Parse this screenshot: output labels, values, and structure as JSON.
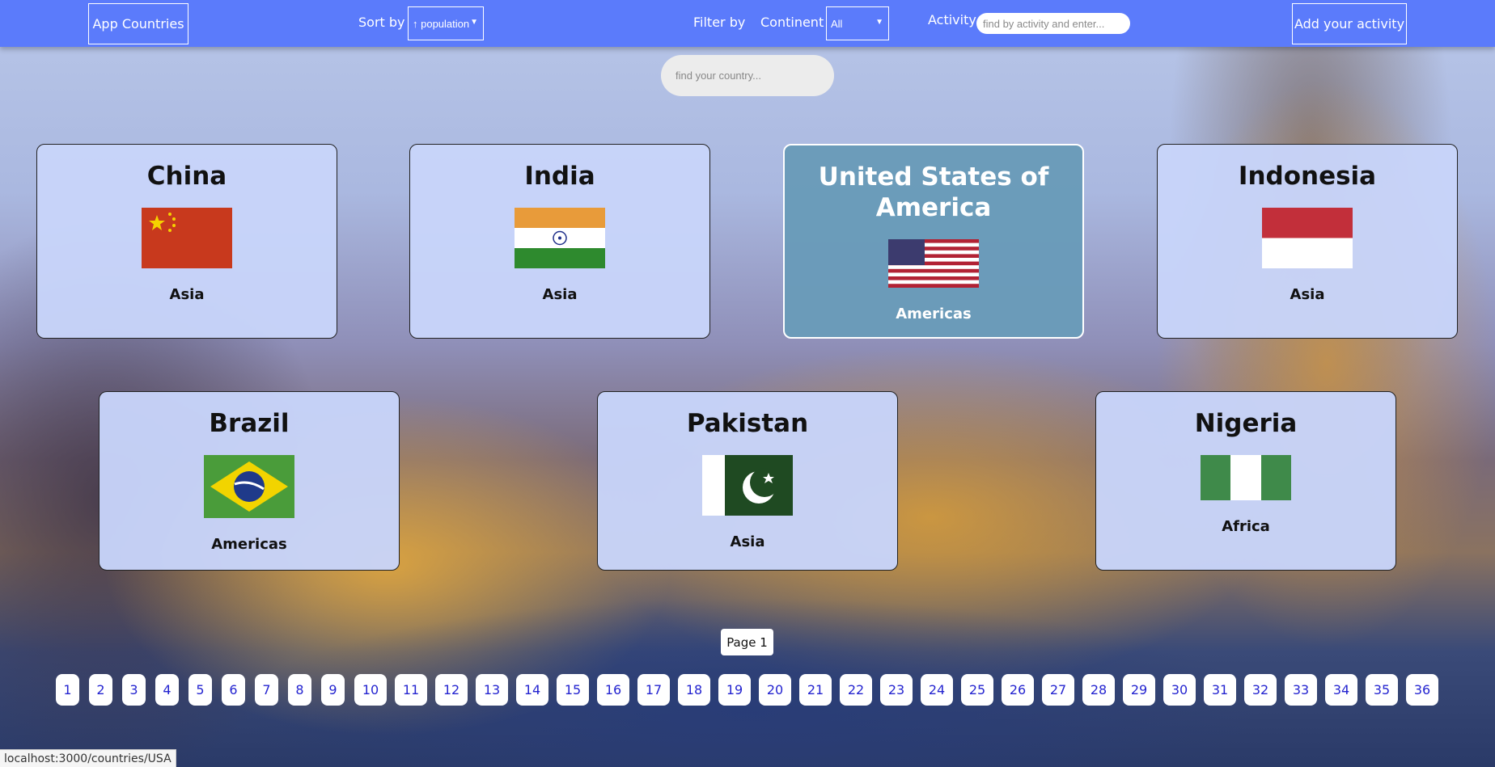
{
  "navbar": {
    "brand": "App Countries",
    "sort_label": "Sort by",
    "sort_value": "↑ population",
    "filter_label": "Filter by",
    "continent_label": "Continent",
    "continent_value": "All",
    "activity_label": "Activity",
    "activity_placeholder": "find by activity and enter...",
    "add_button": "Add your activity"
  },
  "search": {
    "placeholder": "find your country..."
  },
  "countries": [
    {
      "name": "China",
      "continent": "Asia",
      "flag": "china-flag"
    },
    {
      "name": "India",
      "continent": "Asia",
      "flag": "india-flag"
    },
    {
      "name": "United States of America",
      "continent": "Americas",
      "flag": "usa-flag",
      "hovered": true
    },
    {
      "name": "Indonesia",
      "continent": "Asia",
      "flag": "indonesia-flag"
    },
    {
      "name": "Brazil",
      "continent": "Americas",
      "flag": "brazil-flag"
    },
    {
      "name": "Pakistan",
      "continent": "Asia",
      "flag": "pakistan-flag"
    },
    {
      "name": "Nigeria",
      "continent": "Africa",
      "flag": "nigeria-flag"
    }
  ],
  "pagination": {
    "current_label": "Page 1",
    "pages": [
      "1",
      "2",
      "3",
      "4",
      "5",
      "6",
      "7",
      "8",
      "9",
      "10",
      "11",
      "12",
      "13",
      "14",
      "15",
      "16",
      "17",
      "18",
      "19",
      "20",
      "21",
      "22",
      "23",
      "24",
      "25",
      "26",
      "27",
      "28",
      "29",
      "30",
      "31",
      "32",
      "33",
      "34",
      "35",
      "36"
    ]
  },
  "status_bar": {
    "url": "localhost:3000/countries/USA"
  },
  "colors": {
    "navbar": "#5b7bfb",
    "card": "#c8d4fa",
    "card_hover": "#699bb9",
    "page_link": "#2424d0"
  }
}
